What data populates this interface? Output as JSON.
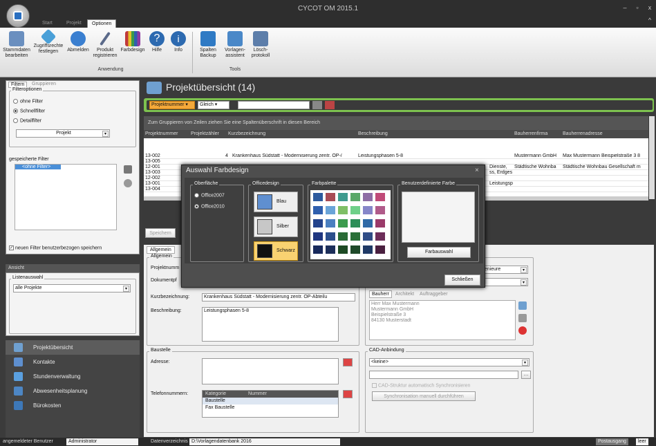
{
  "window": {
    "title": "CYCOT OM 2015.1",
    "min": "–",
    "max": "▫",
    "close": "x",
    "help": "^"
  },
  "tabs": [
    "Start",
    "Projekt",
    "Optionen"
  ],
  "ribbon": {
    "buttons": [
      {
        "label": "Stammdaten bearbeiten",
        "icon": "address-book-icon",
        "color": "#6a8fbf"
      },
      {
        "label": "Zugriffsrechte festlegen",
        "icon": "key-icon",
        "color": "#4aa0d8"
      },
      {
        "label": "Abmelden",
        "icon": "logout-icon",
        "color": "#3a7fd0"
      },
      {
        "label": "Produkt registrieren",
        "icon": "pen-icon",
        "color": "#5b6a8a"
      },
      {
        "label": "Farbdesign",
        "icon": "paint-icon",
        "color": "#c0393b"
      },
      {
        "label": "Hilfe",
        "icon": "help-icon",
        "color": "#2d6ab0"
      },
      {
        "label": "Info",
        "icon": "info-icon",
        "color": "#2d6ab0"
      },
      {
        "label": "Spalten Backup",
        "icon": "columns-icon",
        "color": "#2f7ac4"
      },
      {
        "label": "Vorlagen-assistent",
        "icon": "wizard-icon",
        "color": "#4a88c8"
      },
      {
        "label": "Lösch-protokoll",
        "icon": "printer-icon",
        "color": "#5d7eaa"
      }
    ],
    "groups": [
      "Anwendung",
      "Tools"
    ]
  },
  "left": {
    "tabs": [
      "Filtern",
      "Gruppieren"
    ],
    "filteroptions_caption": "Filteroptionen",
    "radios": [
      "ohne Filter",
      "Schnellfilter",
      "Detailfilter"
    ],
    "selected_radio": 1,
    "detail_select": "Projekt",
    "saved_filter_label": "gespeicherte Filter",
    "saved_filter_item": "<ohne Filter>",
    "checkbox_label": "neuen Filter benutzerbezogen speichern",
    "view_header": "Ansicht",
    "listselect_caption": "Listenauswahl",
    "listselect_value": "alle Projekte",
    "nav": [
      {
        "label": "Projektübersicht",
        "icon": "house-icon",
        "color": "#6fa0d0"
      },
      {
        "label": "Kontakte",
        "icon": "contacts-icon",
        "color": "#5e8fcf"
      },
      {
        "label": "Stundenverwaltung",
        "icon": "hours-icon",
        "color": "#5aa0e0"
      },
      {
        "label": "Abwesenheitsplanung",
        "icon": "calendar-icon",
        "color": "#4d86c4"
      },
      {
        "label": "Bürokosten",
        "icon": "costs-icon",
        "color": "#3d78b8"
      }
    ]
  },
  "main": {
    "title": "Projektübersicht (14)",
    "filter": {
      "field": "Projektnummer",
      "op": "Gleich",
      "value": ""
    },
    "group_hint": "Zum Gruppieren von Zeilen ziehen Sie eine Spaltenüberschrift in diesen Bereich",
    "columns": [
      "Projektnummer",
      "Projektzähler",
      "Kurzbezeichnung",
      "Beschreibung",
      "Bauherrenfirma",
      "Bauherrenadresse"
    ],
    "rows": [
      {
        "nr": "13-002",
        "z": "4",
        "kurz": "Krankenhaus Südstatt - Modernisierung zentr. OP-/",
        "besch": "Leistungsphasen 5-8",
        "firma": "Mustermann GmbH",
        "adr": "Max Mustermann Beispielstraße 3 8"
      },
      {
        "nr": "13-005",
        "z": "",
        "kurz": "",
        "besch": "",
        "firma": "",
        "adr": ""
      },
      {
        "nr": "12-001",
        "z": "",
        "kurz": "",
        "besch": "Dienste,",
        "firma": "Städtische Wohnba",
        "adr": "Städtische Wohnbau Gesellschaft m"
      },
      {
        "nr": "13-003",
        "z": "",
        "kurz": "",
        "besch": "ss, Erdges",
        "firma": "",
        "adr": ""
      },
      {
        "nr": "12-002",
        "z": "",
        "kurz": "",
        "besch": "",
        "firma": "",
        "adr": ""
      },
      {
        "nr": "13-001",
        "z": "",
        "kurz": "",
        "besch": "Leistungsp",
        "firma": "",
        "adr": ""
      },
      {
        "nr": "13-004",
        "z": "",
        "kurz": "",
        "besch": "",
        "firma": "",
        "adr": ""
      }
    ],
    "save_btn": "Speichern",
    "detail_tab": "Allgemein",
    "allgemein_caption": "Allgemein",
    "labels": {
      "projektnr": "Projektnumm",
      "dokumentpfad": "Dokumentpf",
      "kurz": "Kurzbezeichnung:",
      "besch": "Beschreibung:"
    },
    "kurz_value": "Krankenhaus Südstatt - Modernisierung zentr. OP-Abteilu",
    "besch_value": "Leistungsphasen 5-8",
    "ingenieure": "genieure",
    "party_tabs": [
      "Bauherr",
      "Architekt",
      "Auftraggeber"
    ],
    "bauherr": [
      "Herr Max Mustermann",
      "Mustermann GmbH",
      "Beispielstraße 3",
      "84130 Musterstadt"
    ],
    "baustelle_caption": "Baustelle",
    "adresse_label": "Adresse:",
    "telefon_label": "Telefonnummern:",
    "phone_cols": [
      "Kategorie",
      "Nummer"
    ],
    "phone_rows": [
      "Baustelle",
      "Fax Baustelle"
    ],
    "cad_caption": "CAD-Anbindung",
    "cad_value": "<keine>",
    "cad_check": "CAD-Struktur automatisch Synchronisieren",
    "sync_btn": "Synchronisation manuell durchführen"
  },
  "dialog": {
    "title": "Auswahl Farbdesign",
    "close": "×",
    "oberflaeche_caption": "Oberfläche",
    "oberflaeche": [
      "Office2007",
      "Office2010"
    ],
    "selected_oberflaeche": 1,
    "officedesign_caption": "Officedesign",
    "designs": [
      {
        "label": "Blau",
        "color": "#5f8fd0"
      },
      {
        "label": "Silber",
        "color": "#c7c7c7"
      },
      {
        "label": "Schwarz",
        "color": "#111111"
      }
    ],
    "palette_caption": "Farbpalette",
    "palette": [
      "#2d5a9e",
      "#a84b55",
      "#3f9b8e",
      "#5aa868",
      "#8e6da5",
      "#c04a78",
      "#2f5fae",
      "#6aa4d8",
      "#7fbf66",
      "#6fd089",
      "#8686c9",
      "#b05b8a",
      "#23438c",
      "#4a7fc0",
      "#3c9b4d",
      "#2c8e58",
      "#2f6aa6",
      "#9a3a6a",
      "#1f3680",
      "#2c4f8c",
      "#2a6b36",
      "#2a7038",
      "#2f4d86",
      "#6d2e5a",
      "#182a5c",
      "#1d2f5a",
      "#1d4a24",
      "#1f4a2a",
      "#203a66",
      "#4a2040"
    ],
    "userdef_caption": "Benutzerdefinierte Farbe",
    "farbauswahl": "Farbauswahl",
    "schliessen": "Schließen"
  },
  "status": {
    "user_label": "angemeldeter Benutzer",
    "user": "Administrator",
    "dir_label": "Datenverzeichnis",
    "dir": "D:\\Vorlagendatenbank 2016",
    "postausgang": "Postausgang",
    "leer": "leer"
  }
}
